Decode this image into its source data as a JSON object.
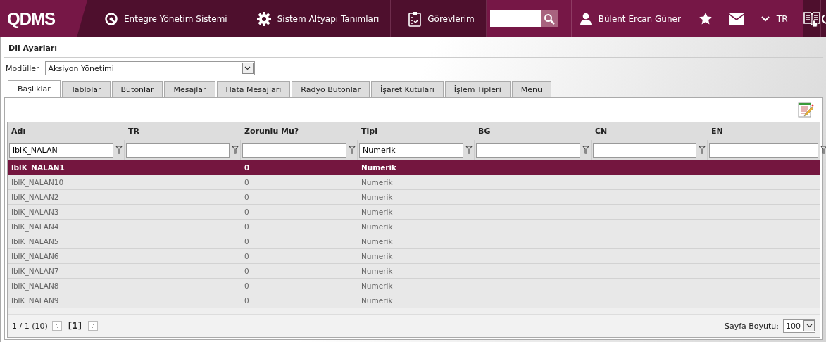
{
  "header": {
    "logo": "QDMS",
    "nav": [
      {
        "kind": "q",
        "label": "Entegre Yönetim Sistemi"
      },
      {
        "kind": "gear",
        "label": "Sistem Altyapı Tanımları"
      },
      {
        "kind": "clipboard",
        "label": "Görevlerim"
      }
    ],
    "user": "Bülent Ercan Güner",
    "language": "TR"
  },
  "page_title": "Dil Ayarları",
  "module_filter": {
    "label": "Modüller",
    "value": "Aksiyon Yönetimi"
  },
  "tabs": [
    {
      "label": "Başlıklar",
      "selected": true
    },
    {
      "label": "Tablolar",
      "selected": false
    },
    {
      "label": "Butonlar",
      "selected": false
    },
    {
      "label": "Mesajlar",
      "selected": false
    },
    {
      "label": "Hata Mesajları",
      "selected": false
    },
    {
      "label": "Radyo Butonlar",
      "selected": false
    },
    {
      "label": "İşaret Kutuları",
      "selected": false
    },
    {
      "label": "İşlem Tipleri",
      "selected": false
    },
    {
      "label": "Menu",
      "selected": false
    }
  ],
  "table": {
    "columns": [
      {
        "label": "Adı",
        "filter": "lblK_NALAN"
      },
      {
        "label": "TR"
      },
      {
        "label": "Zorunlu Mu?"
      },
      {
        "label": "Tipi",
        "filter": "Numerik"
      },
      {
        "label": "BG"
      },
      {
        "label": "CN"
      },
      {
        "label": "EN"
      }
    ],
    "rows": [
      {
        "name": "lblK_NALAN1",
        "required": "0",
        "type": "Numerik",
        "selected": true
      },
      {
        "name": "lblK_NALAN10",
        "required": "0",
        "type": "Numerik",
        "selected": false
      },
      {
        "name": "lblK_NALAN2",
        "required": "0",
        "type": "Numerik",
        "selected": false
      },
      {
        "name": "lblK_NALAN3",
        "required": "0",
        "type": "Numerik",
        "selected": false
      },
      {
        "name": "lblK_NALAN4",
        "required": "0",
        "type": "Numerik",
        "selected": false
      },
      {
        "name": "lblK_NALAN5",
        "required": "0",
        "type": "Numerik",
        "selected": false
      },
      {
        "name": "lblK_NALAN6",
        "required": "0",
        "type": "Numerik",
        "selected": false
      },
      {
        "name": "lblK_NALAN7",
        "required": "0",
        "type": "Numerik",
        "selected": false
      },
      {
        "name": "lblK_NALAN8",
        "required": "0",
        "type": "Numerik",
        "selected": false
      },
      {
        "name": "lblK_NALAN9",
        "required": "0",
        "type": "Numerik",
        "selected": false
      }
    ]
  },
  "pager": {
    "summary": "1 / 1 (10)",
    "current_page": "[1]",
    "page_size_label": "Sayfa Boyutu:",
    "page_size": "100"
  }
}
